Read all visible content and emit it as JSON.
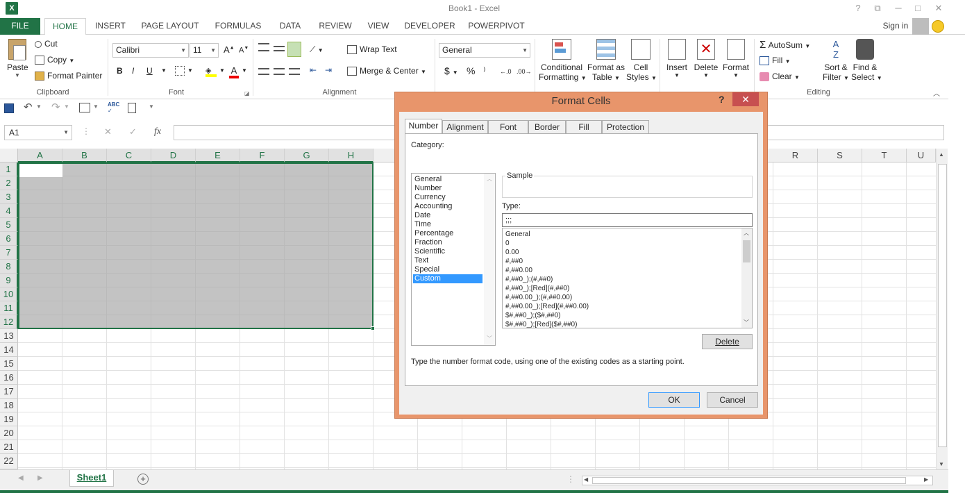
{
  "window": {
    "title": "Book1 - Excel",
    "logo": "X",
    "help_glyph": "?",
    "restore_glyph": "⧉",
    "minimize_glyph": "─",
    "maximize_glyph": "□",
    "close_glyph": "✕"
  },
  "tabs": [
    "FILE",
    "HOME",
    "INSERT",
    "PAGE LAYOUT",
    "FORMULAS",
    "DATA",
    "REVIEW",
    "VIEW",
    "DEVELOPER",
    "POWERPIVOT"
  ],
  "user": {
    "sign_in": "Sign in"
  },
  "ribbon": {
    "clipboard": {
      "paste": "Paste",
      "cut": "Cut",
      "copy": "Copy",
      "format_painter": "Format Painter",
      "label": "Clipboard"
    },
    "font": {
      "name": "Calibri",
      "size": "11",
      "grow": "A",
      "shrink": "A",
      "bold": "B",
      "italic": "I",
      "underline": "U",
      "font_color_letter": "A",
      "label": "Font"
    },
    "alignment": {
      "wrap": "Wrap Text",
      "merge": "Merge & Center",
      "label": "Alignment"
    },
    "number": {
      "format": "General",
      "currency": "$",
      "percent": "%",
      "comma": "⁾",
      "inc_dec": "←.0",
      "dec_dec": ".00→"
    },
    "styles": {
      "conditional_1": "Conditional",
      "conditional_2": "Formatting",
      "format_table_1": "Format as",
      "format_table_2": "Table",
      "cell_styles_1": "Cell",
      "cell_styles_2": "Styles"
    },
    "cells": {
      "insert": "Insert",
      "delete": "Delete",
      "format": "Format"
    },
    "editing": {
      "autosum": "AutoSum",
      "fill": "Fill",
      "clear": "Clear",
      "sort_1": "Sort &",
      "sort_2": "Filter",
      "find_1": "Find &",
      "find_2": "Select",
      "label": "Editing"
    }
  },
  "formula_bar": {
    "name_box": "A1",
    "fx": "fx",
    "cancel": "✕",
    "enter": "✓",
    "value": ""
  },
  "columns": [
    "A",
    "B",
    "C",
    "D",
    "E",
    "F",
    "G",
    "H"
  ],
  "right_columns": [
    "R",
    "S",
    "T",
    "U"
  ],
  "rows": [
    "1",
    "2",
    "3",
    "4",
    "5",
    "6",
    "7",
    "8",
    "9",
    "10",
    "11",
    "12",
    "13",
    "14",
    "15",
    "16",
    "17",
    "18",
    "19",
    "20",
    "21",
    "22"
  ],
  "sheet": {
    "tab": "Sheet1",
    "add": "+"
  },
  "dialog": {
    "title": "Format Cells",
    "help": "?",
    "close": "✕",
    "tabs": [
      "Number",
      "Alignment",
      "Font",
      "Border",
      "Fill",
      "Protection"
    ],
    "category_label": "Category:",
    "categories": [
      "General",
      "Number",
      "Currency",
      "Accounting",
      "Date",
      "Time",
      "Percentage",
      "Fraction",
      "Scientific",
      "Text",
      "Special",
      "Custom"
    ],
    "selected_category": "Custom",
    "sample_label": "Sample",
    "type_label": "Type:",
    "type_value": ";;;",
    "formats": [
      "General",
      "0",
      "0.00",
      "#,##0",
      "#,##0.00",
      "#,##0_);(#,##0)",
      "#,##0_);[Red](#,##0)",
      "#,##0.00_);(#,##0.00)",
      "#,##0.00_);[Red](#,##0.00)",
      "$#,##0_);($#,##0)",
      "$#,##0_);[Red]($#,##0)"
    ],
    "delete": "Delete",
    "hint": "Type the number format code, using one of the existing codes as a starting point.",
    "ok": "OK",
    "cancel": "Cancel"
  }
}
